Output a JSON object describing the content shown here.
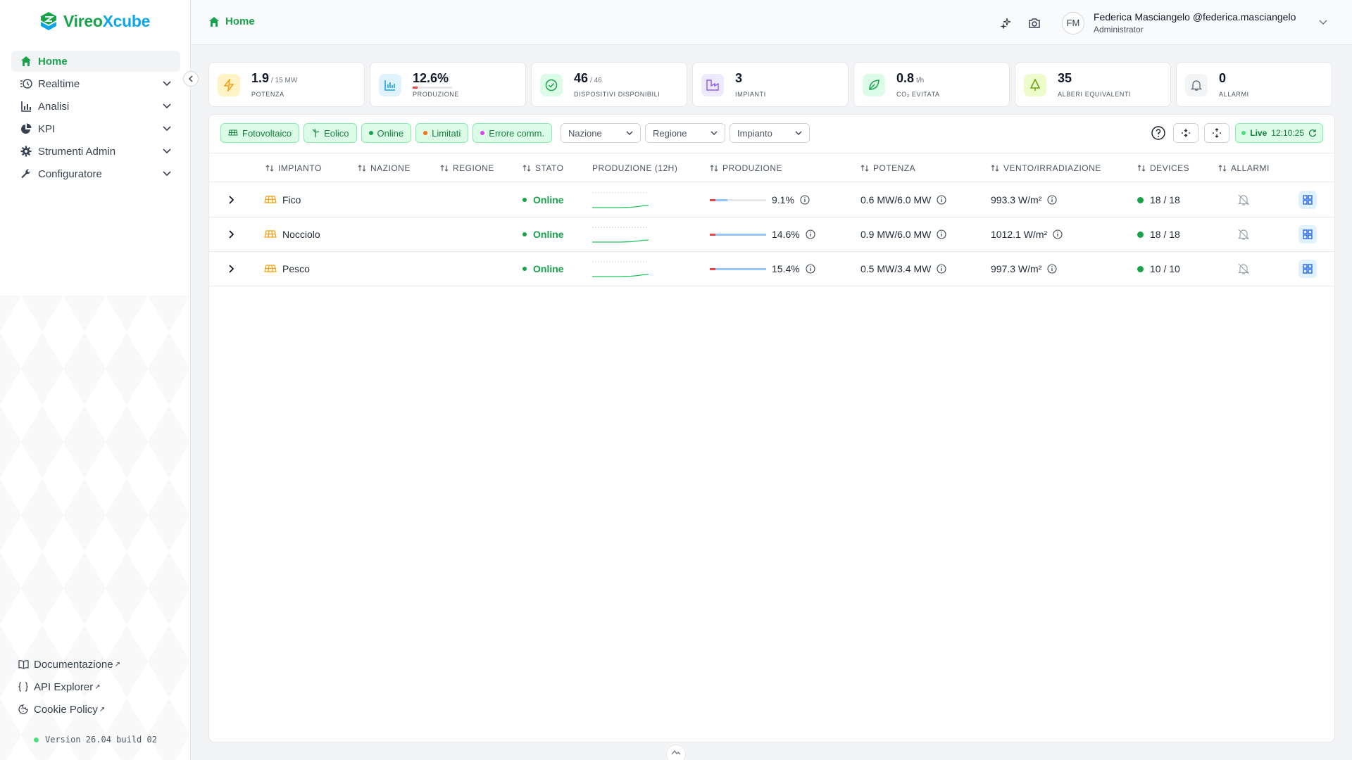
{
  "app": {
    "name_part1": "Vireo",
    "name_part2": "Xcube"
  },
  "nav": {
    "items": [
      {
        "label": "Home",
        "icon": "home-icon"
      },
      {
        "label": "Realtime",
        "icon": "realtime-icon"
      },
      {
        "label": "Analisi",
        "icon": "chart-bar-icon"
      },
      {
        "label": "KPI",
        "icon": "pie-icon"
      },
      {
        "label": "Strumenti Admin",
        "icon": "gear-icon"
      },
      {
        "label": "Configuratore",
        "icon": "wrench-icon"
      }
    ],
    "links": [
      {
        "label": "Documentazione",
        "icon": "book-icon"
      },
      {
        "label": "API Explorer",
        "icon": "braces-icon"
      },
      {
        "label": "Cookie Policy",
        "icon": "cookie-icon"
      }
    ],
    "version": "Version 26.04 build 02"
  },
  "header": {
    "breadcrumb": "Home",
    "user_name": "Federica Masciangelo @federica.masciangelo",
    "user_role": "Administrator",
    "avatar_initials": "FM"
  },
  "kpis": [
    {
      "value": "1.9",
      "unit": "/ 15 MW",
      "label": "Potenza",
      "icon": "bolt-icon",
      "color": "#f59e0b",
      "bg": "#fef3c7"
    },
    {
      "value": "12.6%",
      "unit": "",
      "label": "Produzione",
      "icon": "bar-chart-icon",
      "color": "#0ea5e9",
      "bg": "#e0f2fe",
      "progress": 0.126
    },
    {
      "value": "46",
      "unit": "/ 46",
      "label": "Dispositivi disponibili",
      "icon": "check-circle-icon",
      "color": "#16a34a",
      "bg": "#dcfce7"
    },
    {
      "value": "3",
      "unit": "",
      "label": "Impianti",
      "icon": "factory-icon",
      "color": "#8b5cf6",
      "bg": "#ede9fe"
    },
    {
      "value": "0.8",
      "unit": "t/h",
      "label": "CO₂ Evitata",
      "icon": "leaf-icon",
      "color": "#16a34a",
      "bg": "#dcfce7"
    },
    {
      "value": "35",
      "unit": "",
      "label": "Alberi equivalenti",
      "icon": "tree-icon",
      "color": "#65a30d",
      "bg": "#ecfccb"
    },
    {
      "value": "0",
      "unit": "",
      "label": "Allarmi",
      "icon": "bell-off-icon",
      "color": "#6b7280",
      "bg": "#f3f4f6"
    }
  ],
  "filters": {
    "chips": [
      {
        "label": "Fotovoltaico",
        "icon": "solar-icon"
      },
      {
        "label": "Eolico",
        "icon": "wind-icon"
      },
      {
        "label": "Online",
        "dot": "#16a34a"
      },
      {
        "label": "Limitati",
        "dot": "#f97316"
      },
      {
        "label": "Errore comm.",
        "dot": "#d946ef"
      }
    ],
    "selects": [
      "Nazione",
      "Regione",
      "Impianto"
    ],
    "live_label": "Live",
    "live_time": "12:10:25"
  },
  "table": {
    "headers": [
      "Impianto",
      "Nazione",
      "Regione",
      "Stato",
      "Produzione (12h)",
      "Produzione",
      "Potenza",
      "Vento/Irradiazione",
      "Devices",
      "Allarmi"
    ],
    "rows": [
      {
        "name": "Fico",
        "nazione": "",
        "regione": "",
        "stato": "Online",
        "produzione": "9.1%",
        "produzione_value": 0.31,
        "potenza": "0.6 MW/6.0 MW",
        "vento": "993.3 W/m²",
        "devices": "18 / 18"
      },
      {
        "name": "Nocciolo",
        "nazione": "",
        "regione": "",
        "stato": "Online",
        "produzione": "14.6%",
        "produzione_value": 1.0,
        "potenza": "0.9 MW/6.0 MW",
        "vento": "1012.1 W/m²",
        "devices": "18 / 18"
      },
      {
        "name": "Pesco",
        "nazione": "",
        "regione": "",
        "stato": "Online",
        "produzione": "15.4%",
        "produzione_value": 1.0,
        "potenza": "0.5 MW/3.4 MW",
        "vento": "997.3 W/m²",
        "devices": "10 / 10"
      }
    ]
  }
}
